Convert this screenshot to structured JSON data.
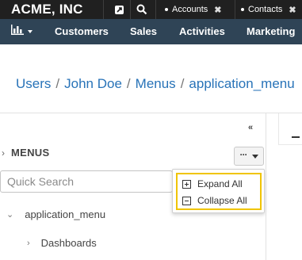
{
  "topbar": {
    "brand": "ACME, INC",
    "icons": [
      "external-link-icon",
      "search-icon"
    ],
    "pinned_tabs": [
      {
        "label": "Accounts"
      },
      {
        "label": "Contacts"
      }
    ],
    "close_glyph": "✖"
  },
  "navbar": {
    "chart_menu_icon": "bar-chart-icon",
    "items": [
      {
        "label": "Customers"
      },
      {
        "label": "Sales"
      },
      {
        "label": "Activities"
      },
      {
        "label": "Marketing"
      }
    ]
  },
  "breadcrumb": {
    "items": [
      "Users",
      "John Doe",
      "Menus",
      "application_menu"
    ],
    "separator": "/"
  },
  "panel": {
    "collapse_glyph": "«",
    "title": "MENUS",
    "more_glyph": "···",
    "search_placeholder": "Quick Search",
    "dropdown": {
      "expand_label": "Expand All",
      "collapse_label": "Collapse All",
      "highlight_color": "#f0c400"
    },
    "tree": [
      {
        "label": "application_menu",
        "expanded": true
      },
      {
        "label": "Dashboards",
        "expanded": false
      }
    ]
  },
  "colors": {
    "topbar_bg": "#202020",
    "navbar_bg": "#2f4456",
    "link": "#2873b8"
  }
}
